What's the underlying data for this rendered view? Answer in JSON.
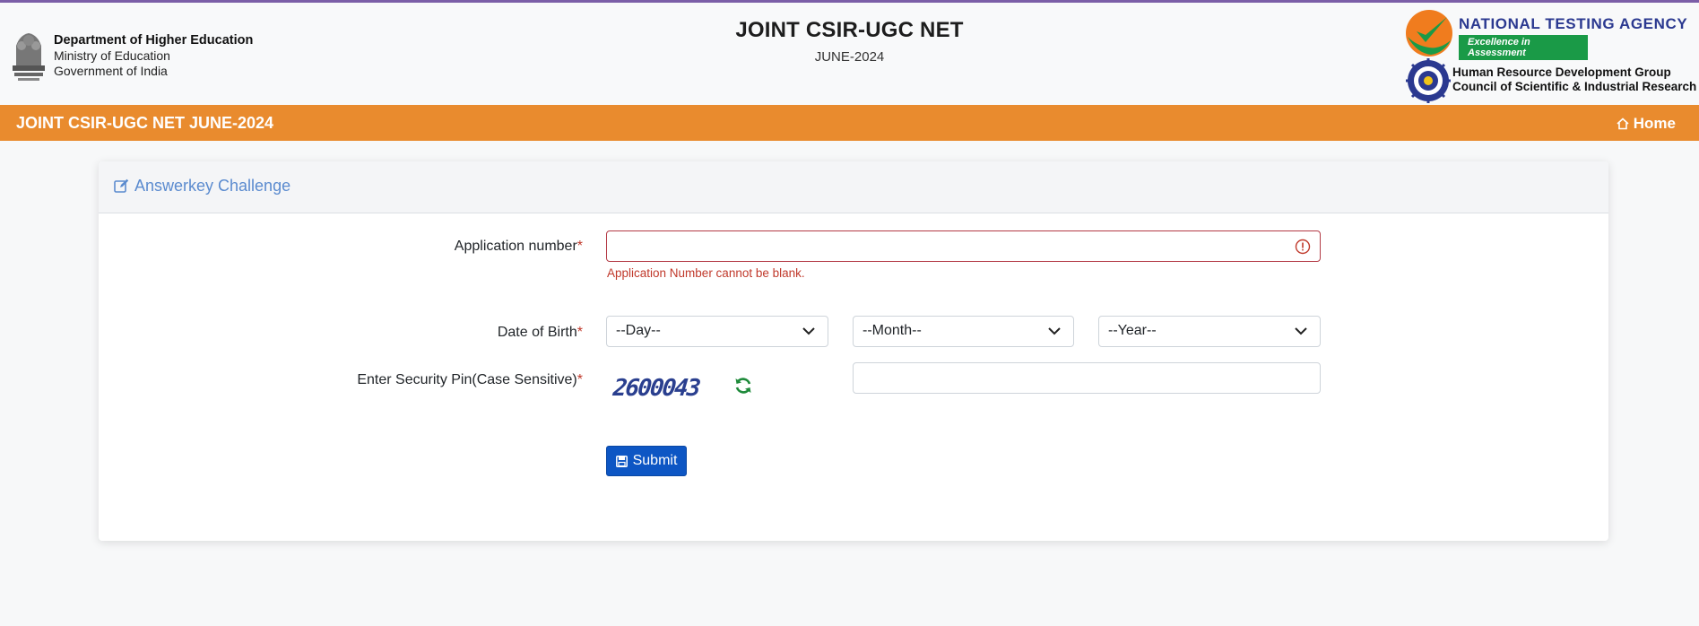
{
  "header": {
    "dept_line1": "Department of Higher Education",
    "dept_line2": "Ministry of Education",
    "dept_line3": "Government of India",
    "exam_title": "JOINT CSIR-UGC NET",
    "exam_session": "JUNE-2024",
    "nta_name": "NATIONAL TESTING AGENCY",
    "nta_tagline": "Excellence in Assessment",
    "hrdg_line1": "Human Resource Development Group",
    "hrdg_line2": "Council of Scientific & Industrial Research"
  },
  "navbar": {
    "title": "JOINT CSIR-UGC NET JUNE-2024",
    "home_label": "Home"
  },
  "card": {
    "title": "Answerkey Challenge"
  },
  "form": {
    "application_label": "Application number",
    "application_value": "",
    "application_error": "Application Number cannot be blank.",
    "dob_label": "Date of Birth",
    "day_selected": "--Day--",
    "month_selected": "--Month--",
    "year_selected": "--Year--",
    "pin_label": "Enter Security Pin(Case Sensitive)",
    "captcha_text": "2600043",
    "pin_value": "",
    "required_mark": "*",
    "submit_label": "Submit"
  },
  "colors": {
    "accent_orange": "#e98b2e",
    "title_blue": "#5b8bcf",
    "button_blue": "#0d56c4",
    "error_red": "#c0392b"
  }
}
